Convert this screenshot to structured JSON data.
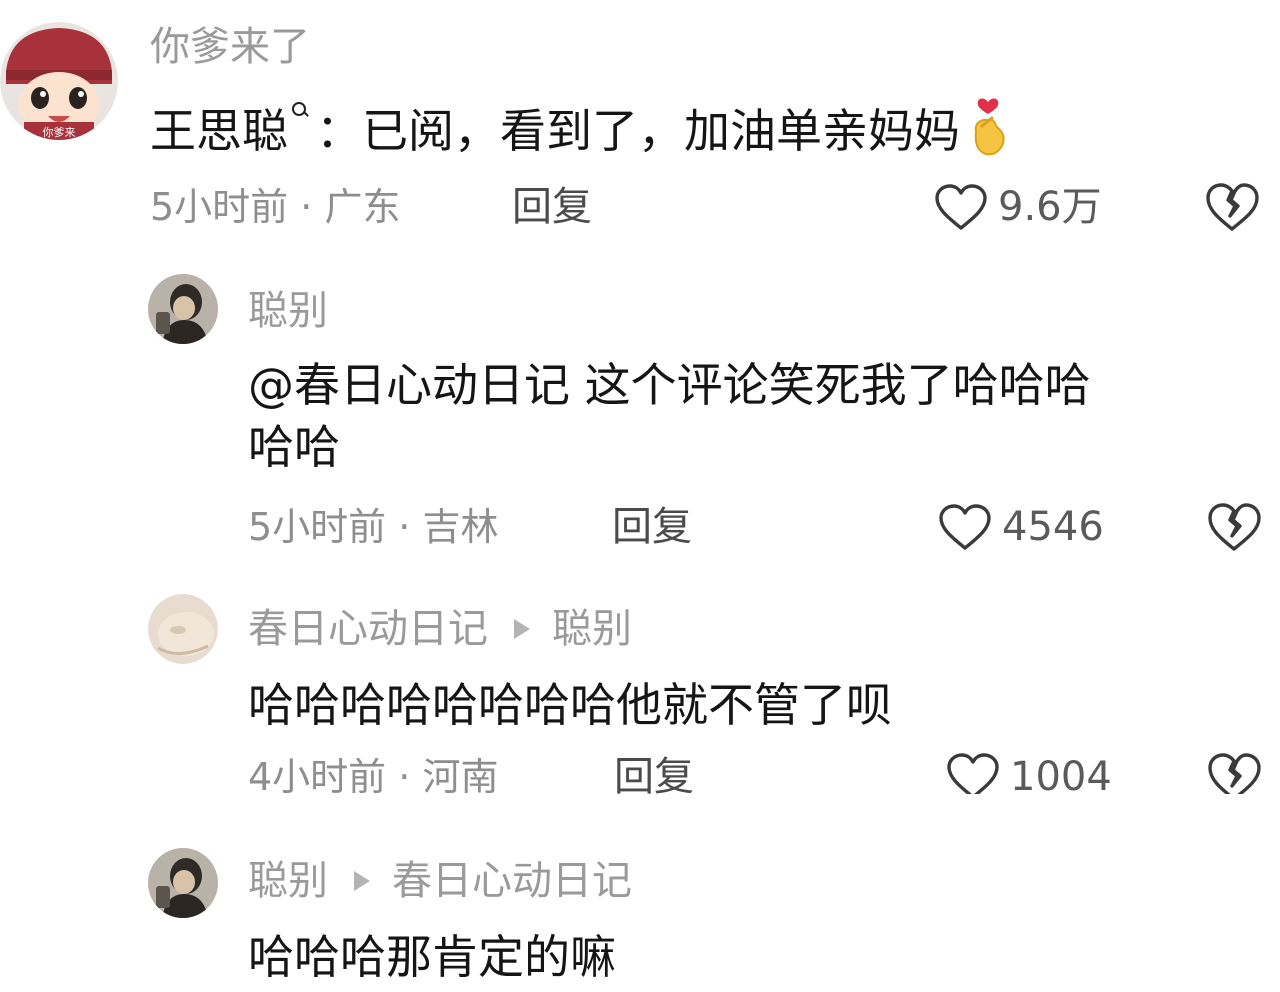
{
  "comments": [
    {
      "username": "你爹来了",
      "prefix": "王思聪",
      "text": "：已阅，看到了，加油单亲妈妈",
      "time": "5小时前",
      "location": "广东",
      "reply_label": "回复",
      "likes": "9.6万",
      "avatar_text": "你爹来",
      "emoji": "finger-heart-emoji"
    },
    {
      "username": "聪别",
      "text_line1": "@春日心动日记 这个评论笑死我了哈哈哈",
      "text_line2": "哈哈",
      "time": "5小时前",
      "location": "吉林",
      "reply_label": "回复",
      "likes": "4546"
    },
    {
      "username": "春日心动日记",
      "reply_to": "聪别",
      "text": "哈哈哈哈哈哈哈哈他就不管了呗",
      "time": "4小时前",
      "location": "河南",
      "reply_label": "回复",
      "likes": "1004"
    },
    {
      "username": "聪别",
      "reply_to": "春日心动日记",
      "text": "哈哈哈那肯定的嘛"
    }
  ],
  "separator": " · ",
  "colors": {
    "text": "#151515",
    "secondary": "#9a9a9a",
    "reply": "#4b4b4b",
    "heart": "#e0304a",
    "emoji": "#f5c542"
  },
  "icons": [
    "heart-outline-icon",
    "broken-heart-icon",
    "search-icon",
    "triangle-arrow-icon"
  ]
}
